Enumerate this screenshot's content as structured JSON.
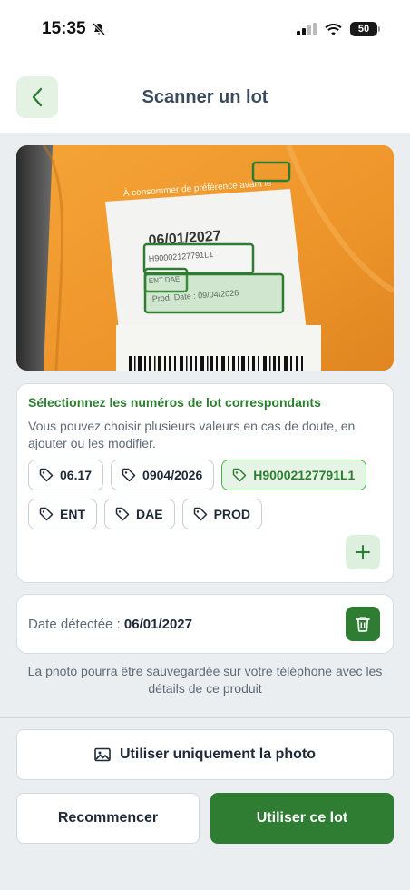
{
  "status_bar": {
    "time": "15:35",
    "battery": "50"
  },
  "header": {
    "title": "Scanner un lot"
  },
  "photo": {
    "label_texts": [
      "À consommer de préférence avant le",
      "06/01/2027",
      "H90002127791L1",
      "ENT DAE",
      "Prod. Date : 09/04/2026"
    ]
  },
  "lots": {
    "title": "Sélectionnez les numéros de lot correspondants",
    "help": "Vous pouvez choisir plusieurs valeurs en cas de doute, en ajouter ou les modifier.",
    "chips": [
      {
        "label": "06.17",
        "selected": false
      },
      {
        "label": "0904/2026",
        "selected": false
      },
      {
        "label": "H90002127791L1",
        "selected": true
      },
      {
        "label": "ENT",
        "selected": false
      },
      {
        "label": "DAE",
        "selected": false
      },
      {
        "label": "PROD",
        "selected": false
      }
    ]
  },
  "date": {
    "label": "Date détectée : ",
    "value": "06/01/2027"
  },
  "note": "La photo pourra être sauvegardée sur votre téléphone avec les détails de ce produit",
  "buttons": {
    "photo_only": "Utiliser uniquement la photo",
    "restart": "Recommencer",
    "use_lot": "Utiliser ce lot"
  },
  "colors": {
    "accent": "#2e7d32",
    "accent_light": "#e3f2e3",
    "background": "#ebeef1"
  }
}
